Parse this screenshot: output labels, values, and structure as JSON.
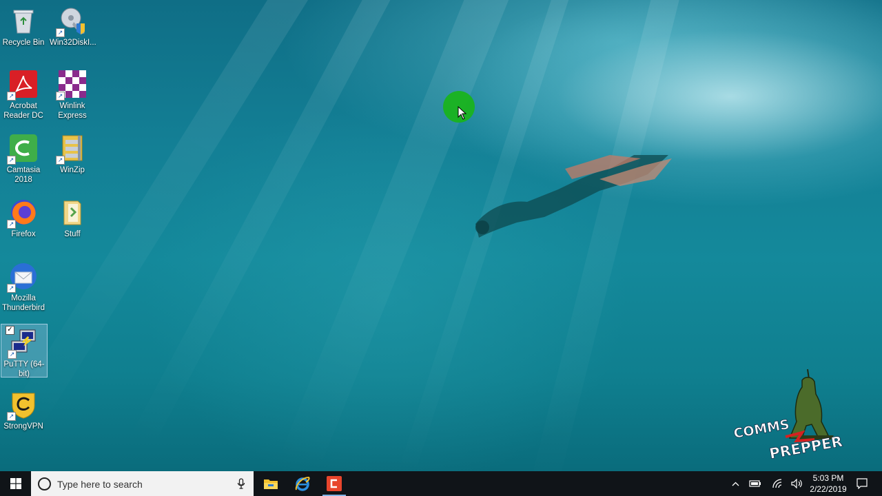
{
  "desktop": {
    "icons": [
      {
        "label": "Recycle Bin",
        "icon": "recycle-bin-icon"
      },
      {
        "label": "Win32DiskI...",
        "icon": "disk-imager-icon"
      },
      {
        "label": "Acrobat Reader DC",
        "icon": "acrobat-icon"
      },
      {
        "label": "Winlink Express",
        "icon": "winlink-icon"
      },
      {
        "label": "Camtasia 2018",
        "icon": "camtasia-icon"
      },
      {
        "label": "WinZip",
        "icon": "winzip-icon"
      },
      {
        "label": "Firefox",
        "icon": "firefox-icon"
      },
      {
        "label": "Stuff",
        "icon": "folder-icon"
      },
      {
        "label": "Mozilla Thunderbird",
        "icon": "thunderbird-icon"
      },
      {
        "label": "PuTTY (64-bit)",
        "icon": "putty-icon",
        "selected": true
      },
      {
        "label": "StrongVPN",
        "icon": "strongvpn-icon"
      }
    ],
    "watermark": {
      "line1": "COMMS",
      "line2": "PREPPER"
    }
  },
  "taskbar": {
    "search_placeholder": "Type here to search",
    "pinned": [
      "file-explorer-icon",
      "internet-explorer-icon",
      "camtasia-icon"
    ],
    "tray": [
      "chevron-up-icon",
      "battery-icon",
      "wifi-icon",
      "volume-icon"
    ],
    "time": "5:03 PM",
    "date": "2/22/2019"
  },
  "colors": {
    "taskbar": "#101418",
    "cursor_highlight": "#19b41a",
    "accent": "#7fb3e6"
  }
}
